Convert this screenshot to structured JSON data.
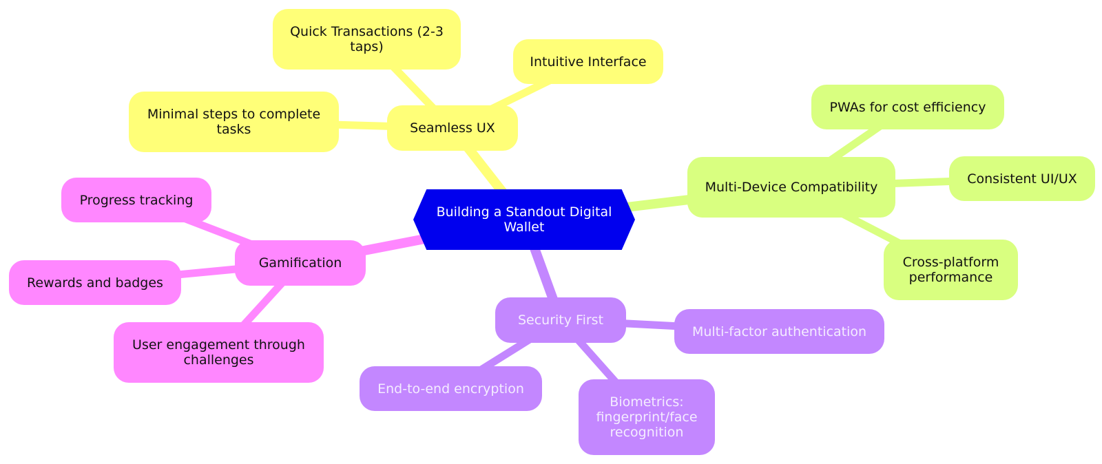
{
  "diagram": {
    "type": "mindmap",
    "root": {
      "id": "root",
      "label": "Building a Standout Digital Wallet",
      "color": "#0000ee",
      "text_color": "#ffffff"
    },
    "branches": [
      {
        "id": "seamless",
        "label": "Seamless UX",
        "color": "#ffff78",
        "text_color": "#111111",
        "children": [
          {
            "id": "quick",
            "label": "Quick Transactions (2-3 taps)"
          },
          {
            "id": "intuitive",
            "label": "Intuitive Interface"
          },
          {
            "id": "minimal",
            "label": "Minimal steps to complete tasks"
          }
        ]
      },
      {
        "id": "multidevice",
        "label": "Multi-Device Compatibility",
        "color": "#d9ff80",
        "text_color": "#111111",
        "children": [
          {
            "id": "pwa",
            "label": "PWAs for cost efficiency"
          },
          {
            "id": "consistent",
            "label": "Consistent UI/UX"
          },
          {
            "id": "crossplatform",
            "label": "Cross-platform performance"
          }
        ]
      },
      {
        "id": "gamification",
        "label": "Gamification",
        "color": "#ff87ff",
        "text_color": "#111111",
        "children": [
          {
            "id": "progress",
            "label": "Progress tracking"
          },
          {
            "id": "rewards",
            "label": "Rewards and badges"
          },
          {
            "id": "engagement",
            "label": "User engagement through challenges"
          }
        ]
      },
      {
        "id": "security",
        "label": "Security First",
        "color": "#c387ff",
        "text_color": "#f4ecff",
        "children": [
          {
            "id": "mfa",
            "label": "Multi-factor authentication"
          },
          {
            "id": "e2e",
            "label": "End-to-end encryption"
          },
          {
            "id": "biometrics",
            "label": "Biometrics: fingerprint/face recognition"
          }
        ]
      }
    ]
  }
}
